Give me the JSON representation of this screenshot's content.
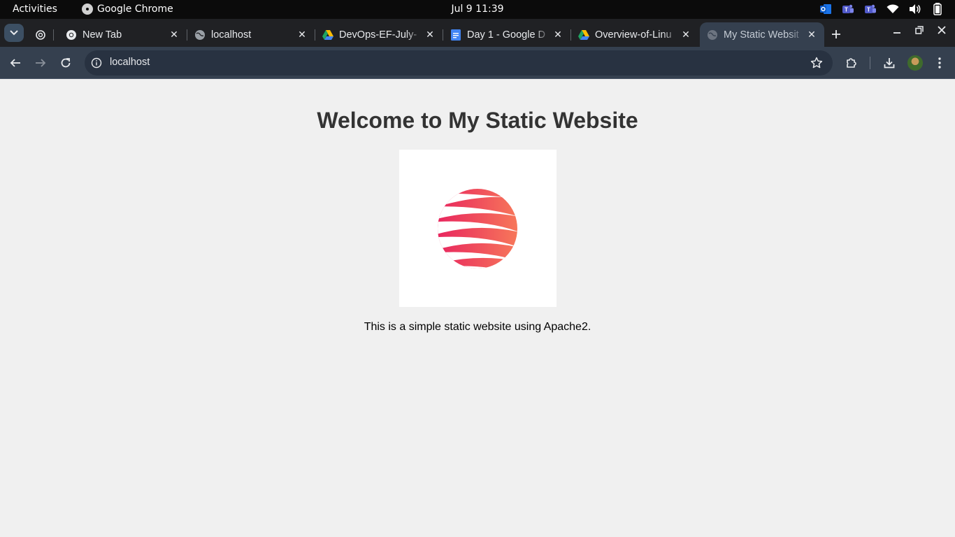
{
  "system_bar": {
    "activities": "Activities",
    "app_name": "Google Chrome",
    "clock": "Jul 9  11:39"
  },
  "tabs": [
    {
      "title": "",
      "icon": "chatgpt-icon",
      "close": ""
    },
    {
      "title": "New Tab",
      "icon": "chrome-icon",
      "close": "✕"
    },
    {
      "title": "localhost",
      "icon": "globe-icon",
      "close": "✕"
    },
    {
      "title": "DevOps-EF-July-",
      "icon": "google-drive-icon",
      "close": "✕"
    },
    {
      "title": "Day 1 - Google D",
      "icon": "google-docs-icon",
      "close": "✕"
    },
    {
      "title": "Overview-of-Linu",
      "icon": "google-drive-icon",
      "close": "✕"
    },
    {
      "title": "My Static Websit",
      "icon": "globe-icon",
      "close": "✕",
      "active": true
    }
  ],
  "toolbar": {
    "url": "localhost"
  },
  "page": {
    "heading": "Welcome to My Static Website",
    "description": "This is a simple static website using Apache2."
  },
  "colors": {
    "logo_gradient_start": "#e8265e",
    "logo_gradient_end": "#f7775a",
    "page_background": "#f0f0f0",
    "toolbar_background": "#35404f"
  }
}
